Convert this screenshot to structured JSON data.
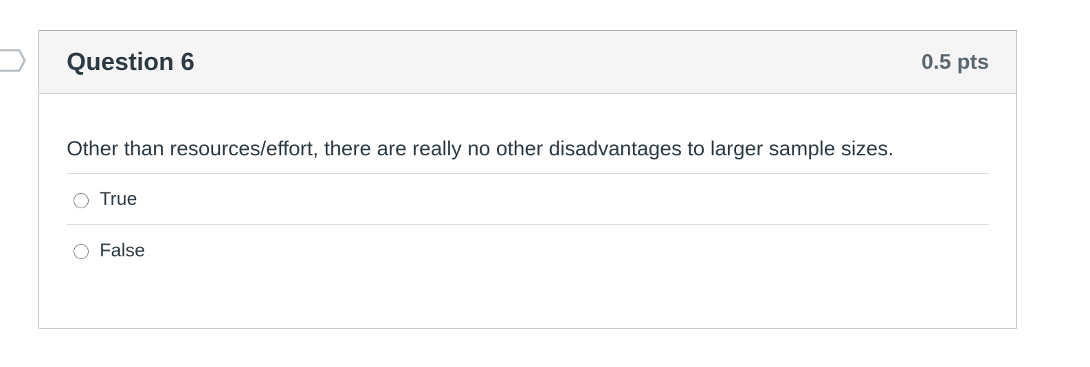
{
  "question": {
    "title": "Question 6",
    "points": "0.5 pts",
    "text": "Other than resources/effort, there are really no other disadvantages to larger sample sizes.",
    "answers": [
      {
        "label": "True",
        "selected": false
      },
      {
        "label": "False",
        "selected": false
      }
    ]
  },
  "icons": {
    "flag": "flag-outline-icon"
  },
  "colors": {
    "header_bg": "#f5f5f5",
    "border": "#a5acb2",
    "text": "#2d3b45",
    "points_text": "#5b6770"
  }
}
